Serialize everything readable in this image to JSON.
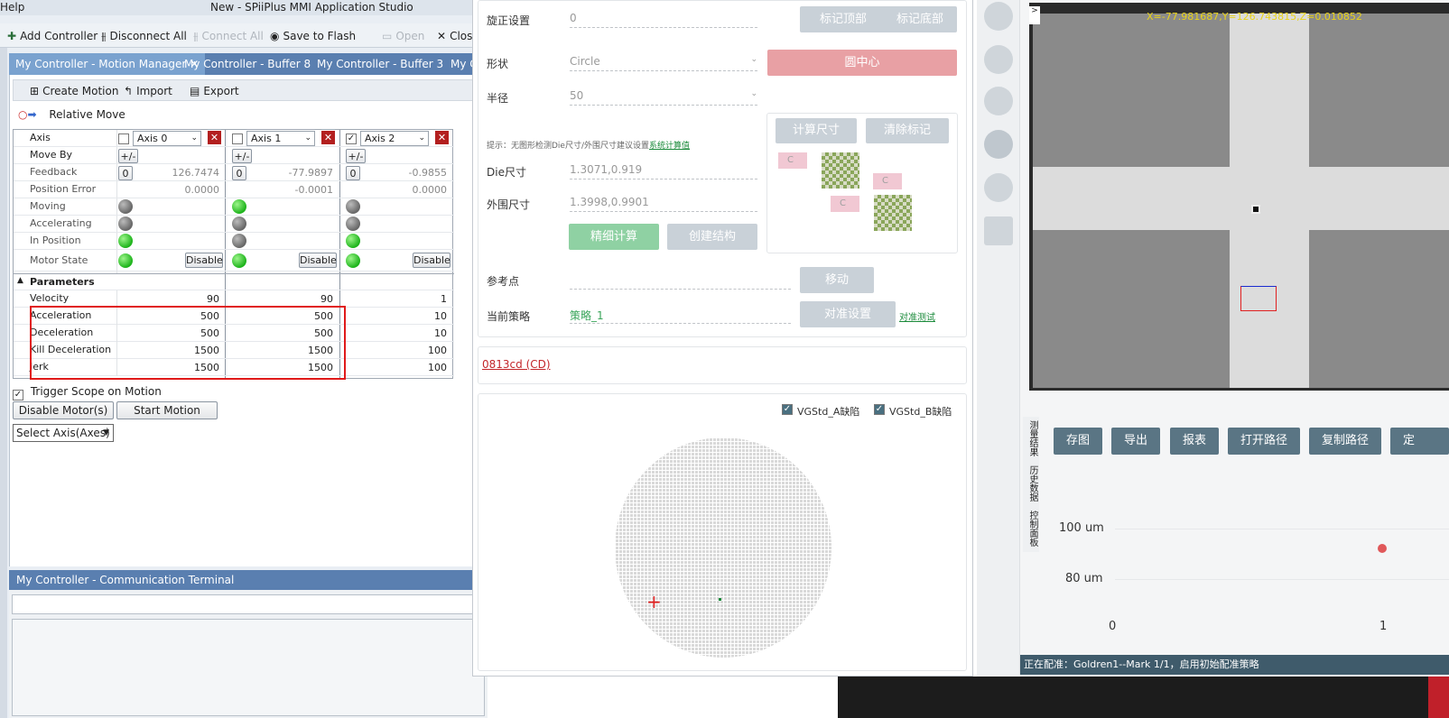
{
  "app": {
    "title": "New - SPiiPlus MMI Application Studio",
    "menu_help": "Help"
  },
  "toolbar": {
    "add_controller": "Add Controller",
    "disconnect_all": "Disconnect All",
    "connect_all": "Connect All",
    "save_to_flash": "Save to Flash",
    "open": "Open",
    "close": "Close"
  },
  "tabs": [
    "My Controller - Motion Manager",
    "My Controller - Buffer 8",
    "My Controller - Buffer 3",
    "My C"
  ],
  "subtoolbar": {
    "create_motion": "Create Motion",
    "import": "Import",
    "export": "Export"
  },
  "relative_move": "Relative Move",
  "axes_table": {
    "axis_label": "Axis",
    "move_by": "Move By",
    "feedback": "Feedback",
    "position_error": "Position Error",
    "moving": "Moving",
    "accelerating": "Accelerating",
    "in_position": "In Position",
    "motor_state": "Motor State",
    "axes": [
      {
        "name": "Axis 0",
        "checked": false,
        "feedback": "126.7474",
        "pos_err": "0.0000",
        "moving": "gray",
        "accel": "gray",
        "inpos": "green",
        "motor": "green"
      },
      {
        "name": "Axis 1",
        "checked": false,
        "feedback": "-77.9897",
        "pos_err": "-0.0001",
        "moving": "green",
        "accel": "gray",
        "inpos": "gray",
        "motor": "green"
      },
      {
        "name": "Axis 2",
        "checked": true,
        "feedback": "-0.9855",
        "pos_err": "0.0000",
        "moving": "gray",
        "accel": "gray",
        "inpos": "green",
        "motor": "green"
      }
    ],
    "plusminus": "+/-",
    "zero": "0",
    "disable": "Disable",
    "parameters": "Parameters",
    "params": [
      {
        "name": "Velocity",
        "v": [
          "90",
          "90",
          "1"
        ]
      },
      {
        "name": "Acceleration",
        "v": [
          "500",
          "500",
          "10"
        ]
      },
      {
        "name": "Deceleration",
        "v": [
          "500",
          "500",
          "10"
        ]
      },
      {
        "name": "Kill Deceleration",
        "v": [
          "1500",
          "1500",
          "100"
        ]
      },
      {
        "name": "Jerk",
        "v": [
          "1500",
          "1500",
          "100"
        ]
      }
    ]
  },
  "trigger_scope": "Trigger Scope on Motion",
  "disable_motors": "Disable Motor(s)",
  "start_motion": "Start Motion",
  "select_axes": "Select Axis(Axes)",
  "comm_terminal": "My Controller - Communication Terminal",
  "dialog": {
    "rotate_label": "旋正设置",
    "rotate_val": "0",
    "mark_top": "标记顶部",
    "mark_bottom": "标记底部",
    "shape_label": "形状",
    "shape_val": "Circle",
    "circle_center": "圆中心",
    "radius_label": "半径",
    "radius_val": "50",
    "hint": "提示：无图形检测Die尺寸/外围尺寸建议设置",
    "hint_link": "系统计算值",
    "die_label": "Die尺寸",
    "die_val": "1.3071,0.919",
    "outer_label": "外围尺寸",
    "outer_val": "1.3998,0.9901",
    "fine_calc": "精细计算",
    "create_struct": "创建结构",
    "calc_size": "计算尺寸",
    "clear_mark": "清除标记",
    "c": "C",
    "ref_label": "参考点",
    "move": "移动",
    "strategy_label": "当前策略",
    "strategy_val": "策略_1",
    "align_setting": "对准设置",
    "align_test": "对准测试",
    "lot_link": "0813cd (CD)",
    "chk_a": "VGStd_A缺陷",
    "chk_b": "VGStd_B缺陷"
  },
  "right": {
    "coords": "X=-77.981687,Y=126.743815,Z=0.010852",
    "side_tabs": [
      "测量结果",
      "历史数据",
      "控制面板"
    ],
    "buttons": [
      "存图",
      "导出",
      "报表",
      "打开路径",
      "复制路径",
      "定"
    ],
    "y_ticks": [
      "100 um",
      "80 um"
    ],
    "x_ticks": [
      "0",
      "1"
    ],
    "status": "正在配准：Goldren1--Mark 1/1，启用初始配准策略"
  }
}
